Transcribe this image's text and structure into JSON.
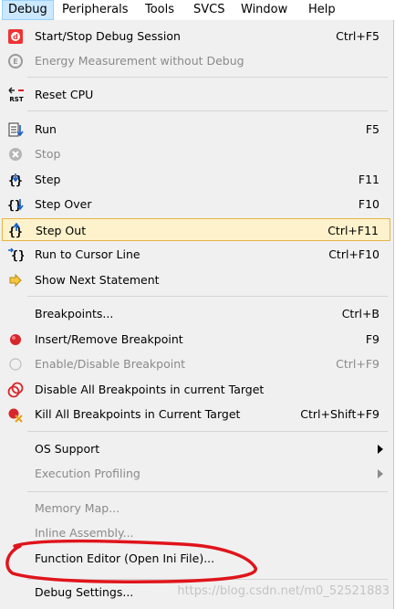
{
  "menubar": {
    "items": [
      {
        "label": "Debug"
      },
      {
        "label": "Peripherals"
      },
      {
        "label": "Tools"
      },
      {
        "label": "SVCS"
      },
      {
        "label": "Window"
      },
      {
        "label": "Help"
      }
    ]
  },
  "menu": {
    "items": [
      {
        "label": "Start/Stop Debug Session",
        "shortcut": "Ctrl+F5"
      },
      {
        "label": "Energy Measurement without Debug",
        "shortcut": ""
      },
      {
        "label": "Reset CPU",
        "shortcut": ""
      },
      {
        "label": "Run",
        "shortcut": "F5"
      },
      {
        "label": "Stop",
        "shortcut": ""
      },
      {
        "label": "Step",
        "shortcut": "F11"
      },
      {
        "label": "Step Over",
        "shortcut": "F10"
      },
      {
        "label": "Step Out",
        "shortcut": "Ctrl+F11"
      },
      {
        "label": "Run to Cursor Line",
        "shortcut": "Ctrl+F10"
      },
      {
        "label": "Show Next Statement",
        "shortcut": ""
      },
      {
        "label": "Breakpoints...",
        "shortcut": "Ctrl+B"
      },
      {
        "label": "Insert/Remove Breakpoint",
        "shortcut": "F9"
      },
      {
        "label": "Enable/Disable Breakpoint",
        "shortcut": "Ctrl+F9"
      },
      {
        "label": "Disable All Breakpoints in current Target",
        "shortcut": ""
      },
      {
        "label": "Kill All Breakpoints in Current Target",
        "shortcut": "Ctrl+Shift+F9"
      },
      {
        "label": "OS Support",
        "shortcut": ""
      },
      {
        "label": "Execution Profiling",
        "shortcut": ""
      },
      {
        "label": "Memory Map...",
        "shortcut": ""
      },
      {
        "label": "Inline Assembly...",
        "shortcut": ""
      },
      {
        "label": "Function Editor (Open Ini File)...",
        "shortcut": ""
      },
      {
        "label": "Debug Settings...",
        "shortcut": ""
      }
    ],
    "icons": {
      "rst_text": "RST"
    }
  },
  "watermark": "https://blog.csdn.net/m0_52521883",
  "colors": {
    "highlight_bg": "#fdf2cc",
    "highlight_border": "#e8b448",
    "annotation": "#e0141b",
    "menubar_active": "#cce8ff"
  }
}
